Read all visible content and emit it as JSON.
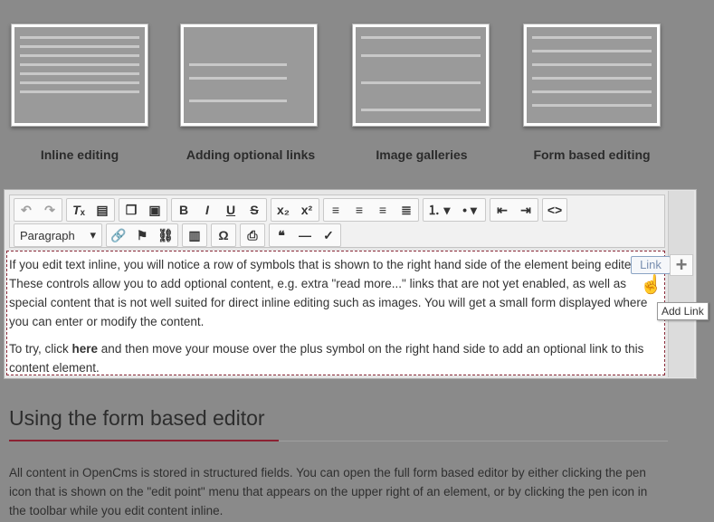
{
  "thumbnails": [
    {
      "label": "Inline editing"
    },
    {
      "label": "Adding optional links"
    },
    {
      "label": "Image galleries"
    },
    {
      "label": "Form based editing"
    }
  ],
  "toolbar": {
    "format_select": "Paragraph"
  },
  "content": {
    "p1": "If you edit text inline, you will notice a row of symbols that is shown to the right hand side of the element being edited. These controls allow you to add optional content, e.g. extra \"read more...\" links that are not yet enabled, as well as special content that is not well suited for direct inline editing such as images. You will get a small form displayed where you can enter or modify the content.",
    "p2_before": "To try, click ",
    "p2_link": "here",
    "p2_after": " and then move your mouse over the plus symbol on the right hand side to add an optional link to this content element."
  },
  "link_popup": "Link",
  "plus_symbol": "+",
  "tooltip": "Add Link",
  "section": {
    "heading": "Using the form based editor",
    "body": "All content in OpenCms is stored in structured fields. You can open the full form based editor by either clicking the pen icon that is shown on the \"edit point\" menu that appears on the upper right of an element, or by clicking the pen icon in the toolbar while you edit content inline."
  },
  "colors": {
    "accent": "#8b2132",
    "overlay": "#8a8a8a"
  }
}
